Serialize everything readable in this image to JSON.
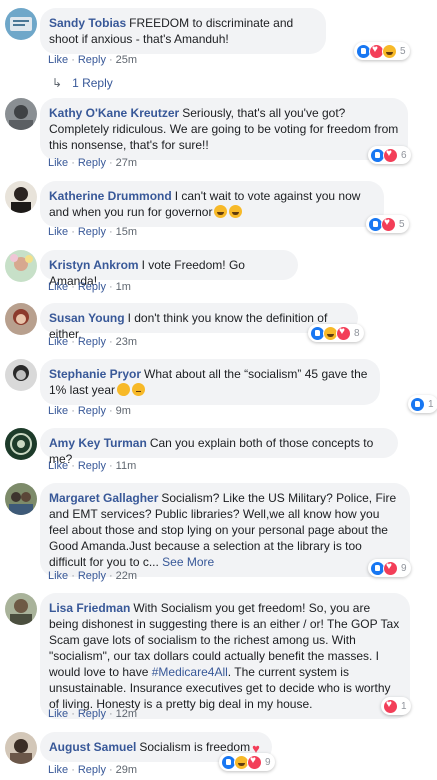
{
  "comments": [
    {
      "author": "Sandy Tobias",
      "text": "FREEDOM to discriminate and shoot if anxious - that's Amanduh!",
      "like": "Like",
      "reply": "Reply",
      "time": "25m",
      "reaction_count": "5"
    },
    {
      "author": "Kathy O'Kane Kreutzer",
      "text": "Seriously, that's all you've got? Completely ridiculous. We are going to be voting for freedom from this nonsense, that's for sure!!",
      "like": "Like",
      "reply": "Reply",
      "time": "27m",
      "reaction_count": "6"
    },
    {
      "author": "Katherine Drummond",
      "text": "I can't wait to vote against you now and when you run for governor",
      "like": "Like",
      "reply": "Reply",
      "time": "15m",
      "reaction_count": "5"
    },
    {
      "author": "Kristyn Ankrom",
      "text": "I vote Freedom! Go Amanda!",
      "like": "Like",
      "reply": "Reply",
      "time": "1m"
    },
    {
      "author": "Susan Young",
      "text": "I don't think you know the definition of either.",
      "like": "Like",
      "reply": "Reply",
      "time": "23m",
      "reaction_count": "8"
    },
    {
      "author": "Stephanie Pryor",
      "text": "What about all the “socialism” 45 gave the 1% last year",
      "like": "Like",
      "reply": "Reply",
      "time": "9m",
      "reaction_count": "1"
    },
    {
      "author": "Amy Key Turman",
      "text": "Can you explain both of those concepts to me?",
      "like": "Like",
      "reply": "Reply",
      "time": "11m"
    },
    {
      "author": "Margaret Gallagher",
      "text": "Socialism? Like the US Military? Police, Fire and EMT services? Public libraries? Well,we all know how you feel about those and stop lying on your personal page about the Good Amanda.Just because a selection at the library is too difficult for you to c...",
      "see_more": "See More",
      "like": "Like",
      "reply": "Reply",
      "time": "22m",
      "reaction_count": "9"
    },
    {
      "author": "Lisa Friedman",
      "text": "With Socialism you get freedom! So, you are being dishonest in suggesting there is an either / or! The GOP Tax Scam gave lots of socialism to the richest among us. With \"socialism\", our tax dollars could actually benefit the masses. I would love to have",
      "hashtag": "#Medicare4All",
      "text2": ". The current system is unsustainable. Insurance executives get to decide who is worthy of living. Honesty is a pretty big deal in my house.",
      "like": "Like",
      "reply": "Reply",
      "time": "12m",
      "reaction_count": "1"
    },
    {
      "author": "August Samuel",
      "text": "Socialism is freedom",
      "like": "Like",
      "reply": "Reply",
      "time": "29m",
      "reaction_count": "9"
    }
  ],
  "replies_link": "1 Reply",
  "colors": {
    "link": "#385898",
    "bubble": "#f2f3f5",
    "like_blue": "#1877f2",
    "love_red": "#f33e58",
    "haha_yellow": "#f7b928"
  }
}
